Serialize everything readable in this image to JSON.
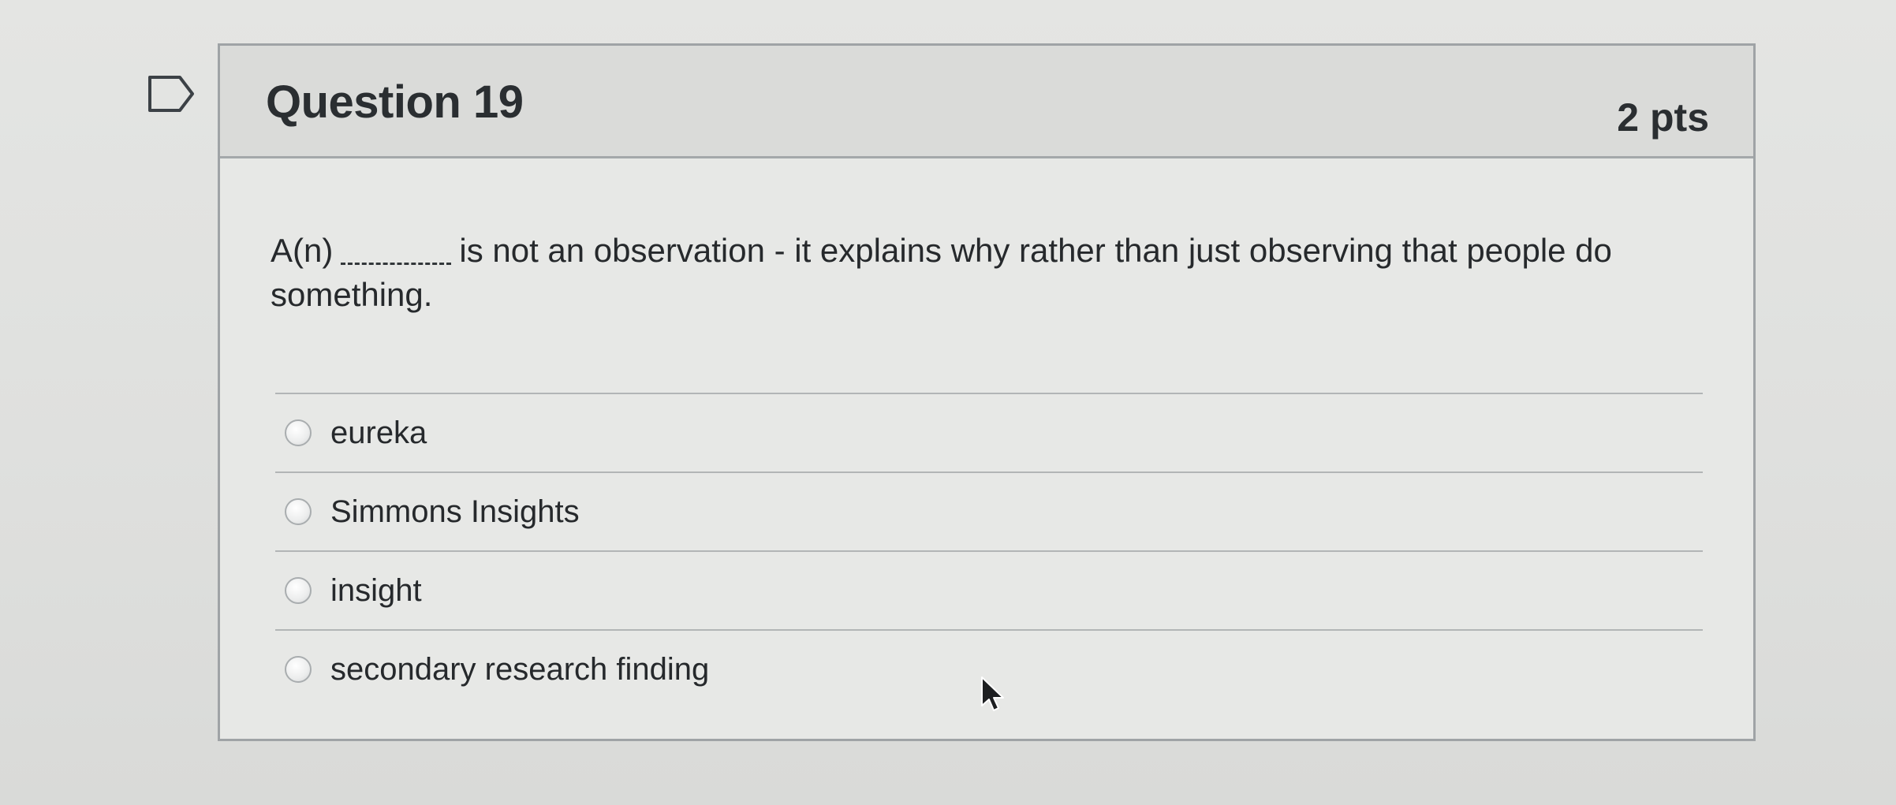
{
  "question": {
    "title": "Question 19",
    "points": "2 pts",
    "text_before_blank": "A(n)",
    "text_after_blank": "is not an observation - it explains why rather than just observing that people do something.",
    "flag_icon": "flag-outline-icon"
  },
  "answers": [
    {
      "label": "eureka",
      "selected": false
    },
    {
      "label": "Simmons Insights",
      "selected": false
    },
    {
      "label": "insight",
      "selected": false
    },
    {
      "label": "secondary research finding",
      "selected": false
    }
  ],
  "colors": {
    "background": "#e1e2e0",
    "card_border": "#9fa3a6",
    "header_bg": "#dadbd9",
    "text": "#26292c"
  },
  "cursor_icon": "mouse-pointer-icon"
}
